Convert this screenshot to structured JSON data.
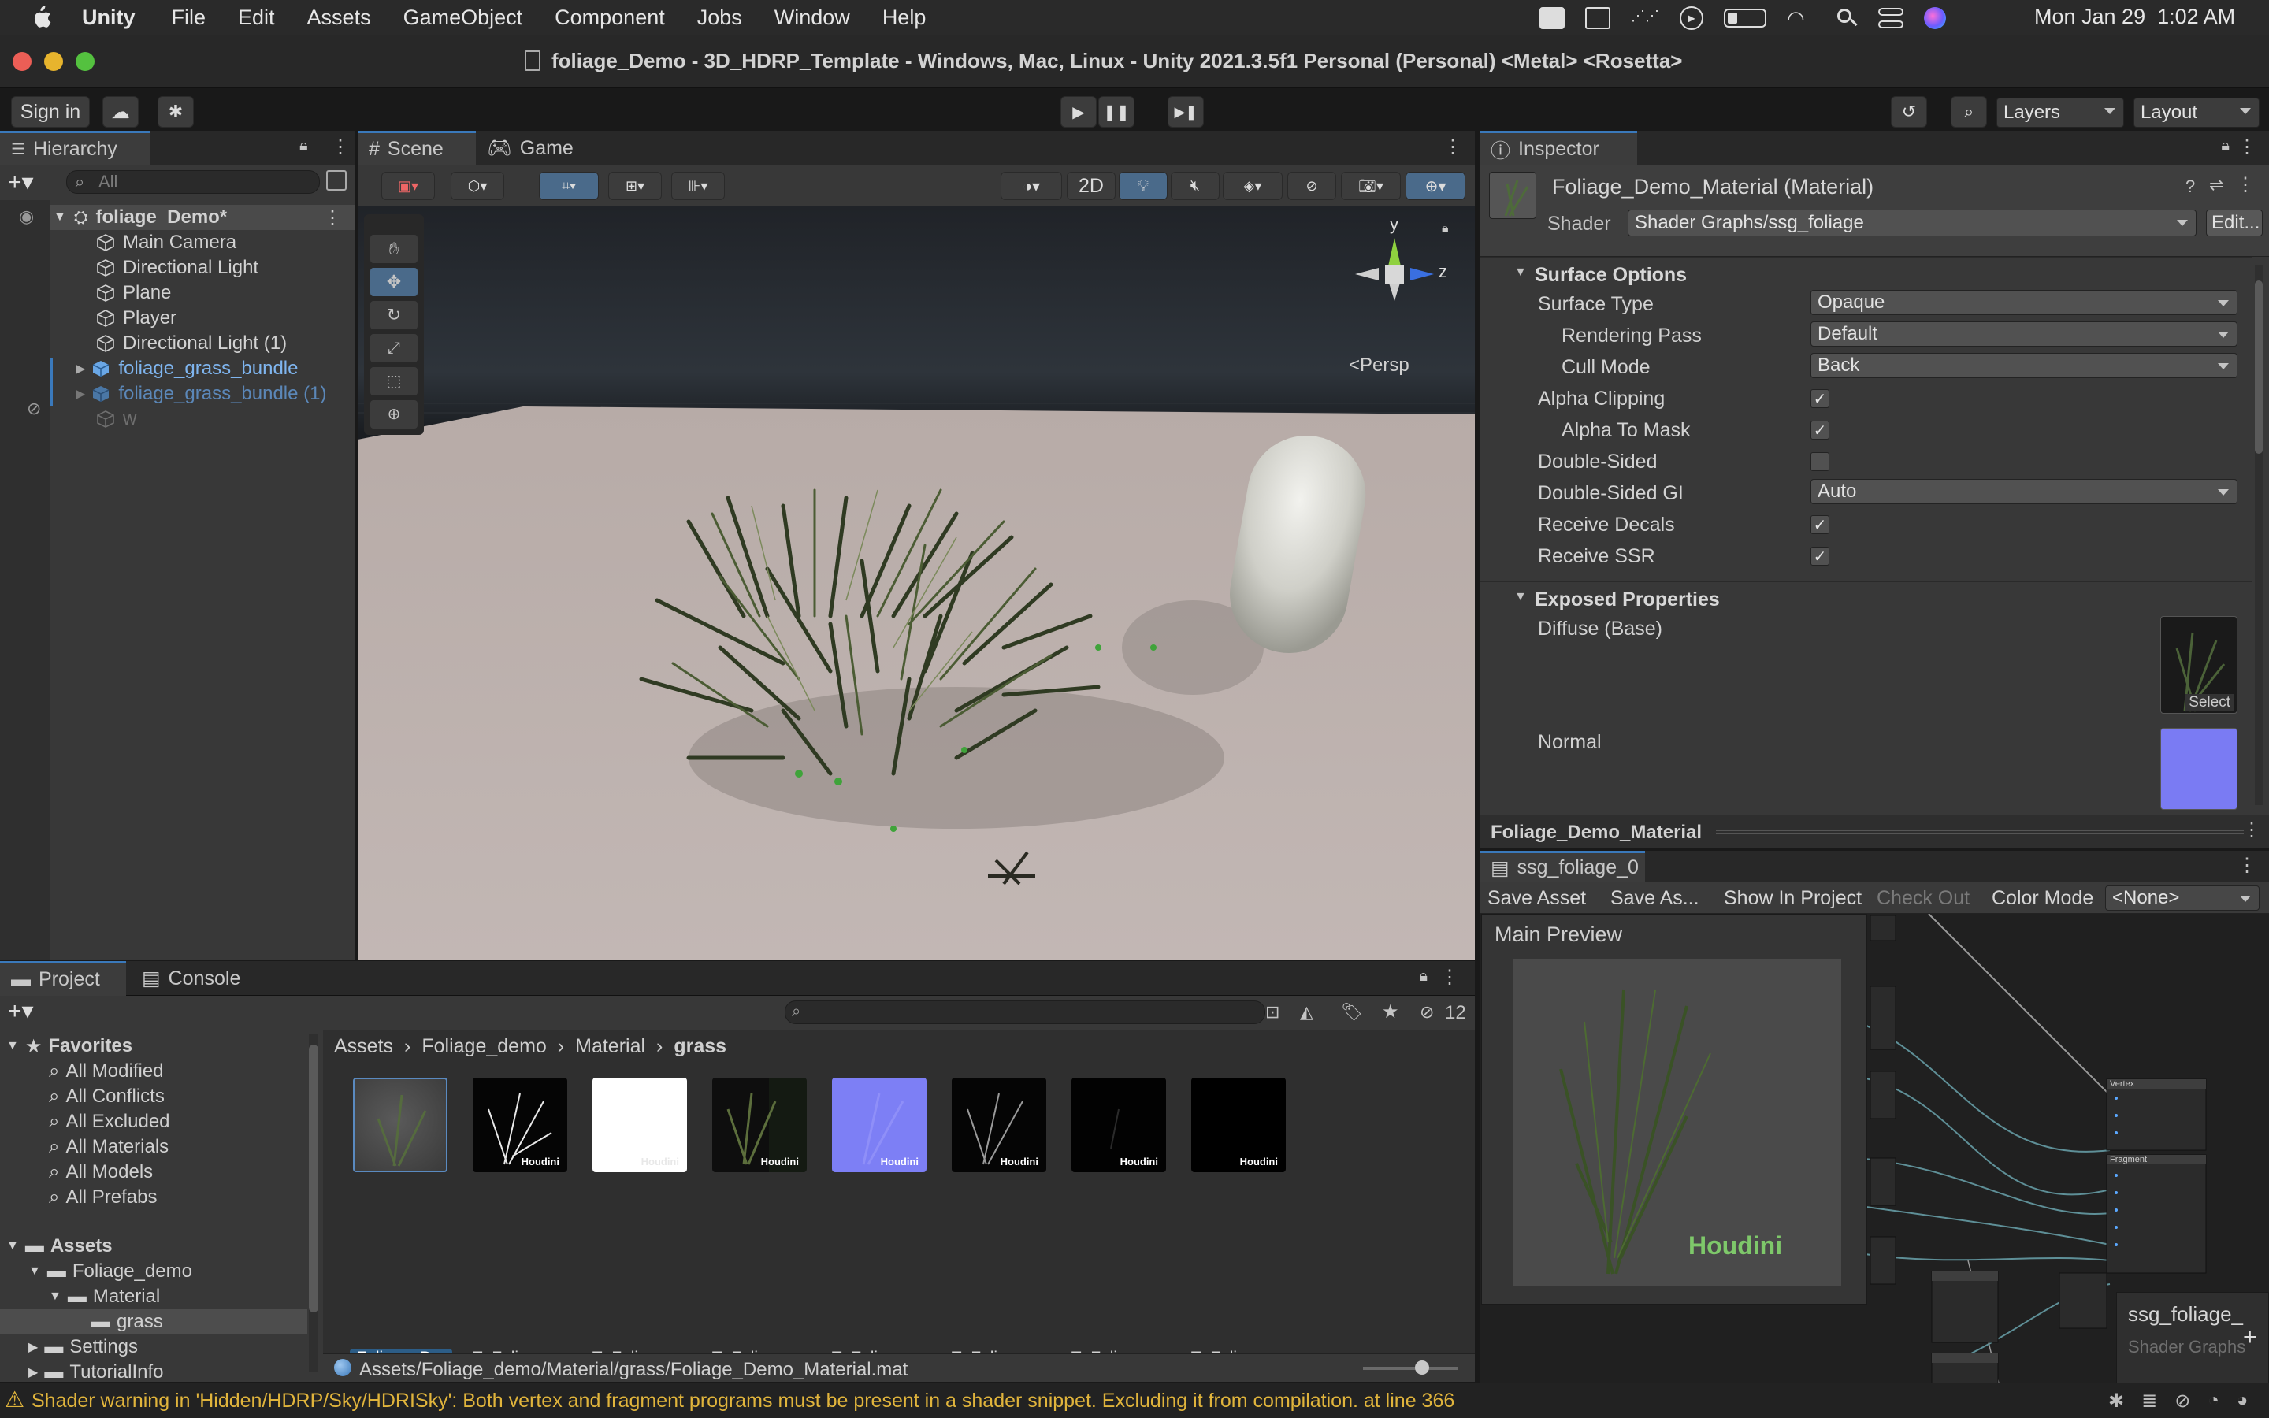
{
  "menubar": {
    "app": "Unity",
    "items": [
      "File",
      "Edit",
      "Assets",
      "GameObject",
      "Component",
      "Jobs",
      "Window",
      "Help"
    ],
    "clock": "Mon Jan 29  1:02 AM"
  },
  "window": {
    "title": "foliage_Demo - 3D_HDRP_Template - Windows, Mac, Linux - Unity 2021.3.5f1 Personal (Personal) <Metal> <Rosetta>"
  },
  "toolbar": {
    "sign_in": "Sign in",
    "layers": "Layers",
    "layout": "Layout"
  },
  "hierarchy": {
    "tab": "Hierarchy",
    "search_placeholder": "All",
    "scene": "foliage_Demo*",
    "items": [
      {
        "label": "Main Camera"
      },
      {
        "label": "Directional Light"
      },
      {
        "label": "Plane"
      },
      {
        "label": "Player"
      },
      {
        "label": "Directional Light (1)"
      },
      {
        "label": "foliage_grass_bundle"
      },
      {
        "label": "foliage_grass_bundle (1)"
      },
      {
        "label": "w"
      }
    ]
  },
  "scene_view": {
    "tabs": [
      "Scene",
      "Game"
    ],
    "btn_2d": "2D",
    "gizmo_y": "y",
    "gizmo_z": "z",
    "persp": "<Persp"
  },
  "inspector": {
    "tab": "Inspector",
    "material_name": "Foliage_Demo_Material (Material)",
    "shader_label": "Shader",
    "shader_value": "Shader Graphs/ssg_foliage",
    "edit": "Edit...",
    "surface_options": "Surface Options",
    "props": [
      {
        "label": "Surface Type",
        "value": "Opaque"
      },
      {
        "label": "Rendering Pass",
        "value": "Default"
      },
      {
        "label": "Cull Mode",
        "value": "Back"
      },
      {
        "label": "Alpha Clipping",
        "checked": true
      },
      {
        "label": "Alpha To Mask",
        "checked": true
      },
      {
        "label": "Double-Sided",
        "checked": false
      },
      {
        "label": "Double-Sided GI",
        "value": "Auto"
      },
      {
        "label": "Receive Decals",
        "checked": true
      },
      {
        "label": "Receive SSR",
        "checked": true
      }
    ],
    "exposed_properties": "Exposed Properties",
    "diffuse_label": "Diffuse (Base)",
    "select": "Select",
    "normal_label": "Normal",
    "footer": "Foliage_Demo_Material"
  },
  "shader_graph": {
    "tab": "ssg_foliage_0",
    "save_asset": "Save Asset",
    "save_as": "Save As...",
    "show_in_project": "Show In Project",
    "check_out": "Check Out",
    "color_mode_label": "Color Mode",
    "color_mode_value": "<None>",
    "main_preview": "Main Preview",
    "houdini": "Houdini",
    "blackboard_title": "ssg_foliage_",
    "blackboard_sub": "Shader Graphs",
    "vertex": "Vertex",
    "fragment": "Fragment"
  },
  "project": {
    "tabs": [
      "Project",
      "Console"
    ],
    "hidden_count": "12",
    "favorites_title": "Favorites",
    "favorites": [
      "All Modified",
      "All Conflicts",
      "All Excluded",
      "All Materials",
      "All Models",
      "All Prefabs"
    ],
    "assets_title": "Assets",
    "tree": [
      "Foliage_demo",
      "Material",
      "grass",
      "Settings",
      "TutorialInfo"
    ],
    "breadcrumb": [
      "Assets",
      "Foliage_demo",
      "Material",
      "grass"
    ],
    "assets": [
      "Foliage_D...",
      "T_Foliage_...",
      "T_Foliage_...",
      "T_Foliage_...",
      "T_Foliage_...",
      "T_Foliage_...",
      "T_Foliage_...",
      "T_Foliage_..."
    ],
    "thumb_badge": "Houdini",
    "path": "Assets/Foliage_demo/Material/grass/Foliage_Demo_Material.mat"
  },
  "status": {
    "message": "Shader warning in 'Hidden/HDRP/Sky/HDRISky': Both vertex and fragment programs must be present in a shader snippet. Excluding it from compilation. at line 366"
  },
  "colors": {
    "accent": "#3a79bb",
    "selection": "#2c5d87",
    "warning": "#e0b43c"
  }
}
